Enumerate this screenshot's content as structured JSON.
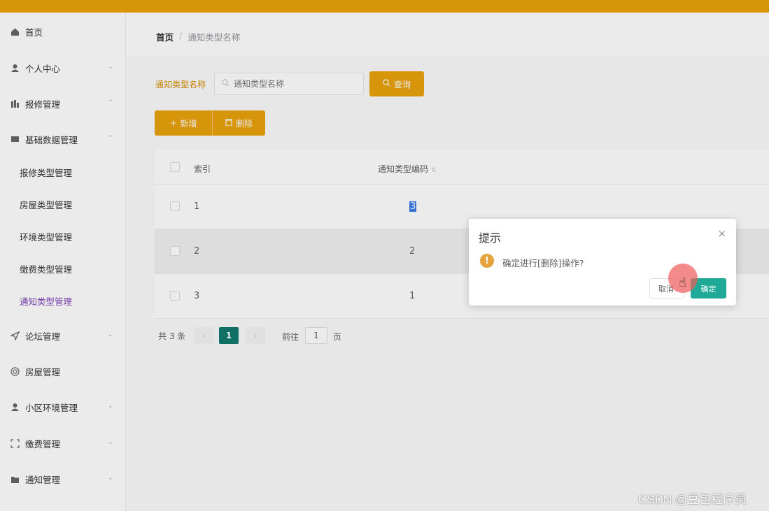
{
  "sidebar": {
    "items": [
      {
        "label": "首页",
        "icon": "home-icon"
      },
      {
        "label": "个人中心",
        "icon": "user-icon"
      },
      {
        "label": "报修管理",
        "icon": "bar-chart-icon"
      },
      {
        "label": "基础数据管理",
        "icon": "message-icon"
      },
      {
        "label": "论坛管理",
        "icon": "send-icon"
      },
      {
        "label": "房屋管理",
        "icon": "target-icon"
      },
      {
        "label": "小区环境管理",
        "icon": "user-icon"
      },
      {
        "label": "缴费管理",
        "icon": "frame-icon"
      },
      {
        "label": "通知管理",
        "icon": "folder-icon"
      }
    ],
    "subitems": [
      {
        "label": "报修类型管理"
      },
      {
        "label": "房屋类型管理"
      },
      {
        "label": "环境类型管理"
      },
      {
        "label": "缴费类型管理"
      },
      {
        "label": "通知类型管理",
        "active": true
      }
    ]
  },
  "breadcrumb": {
    "home": "首页",
    "separator": "/",
    "current": "通知类型名称"
  },
  "search": {
    "label": "通知类型名称",
    "placeholder": "通知类型名称",
    "query_label": "查询"
  },
  "toolbar": {
    "add_label": "新增",
    "delete_label": "删除"
  },
  "table": {
    "headers": {
      "index": "索引",
      "code": "通知类型编码"
    },
    "rows": [
      {
        "index": "1",
        "code": "3"
      },
      {
        "index": "2",
        "code": "2"
      },
      {
        "index": "3",
        "code": "1"
      }
    ]
  },
  "pagination": {
    "total": "共 3 条",
    "current": "1",
    "goto_label": "前往",
    "goto_value": "1",
    "page_suffix": "页"
  },
  "dialog": {
    "title": "提示",
    "message": "确定进行[删除]操作?",
    "cancel_label": "取消",
    "ok_label": "确定",
    "close_icon": "×",
    "warning_icon": "!"
  },
  "watermark": "CSDN @豆包程序员",
  "colors": {
    "topbar": "#e9a20c",
    "accent": "#e9a20c",
    "active_page": "#127a6e",
    "ok_button": "#1eaa96",
    "active_menu": "#7b3fb6"
  }
}
